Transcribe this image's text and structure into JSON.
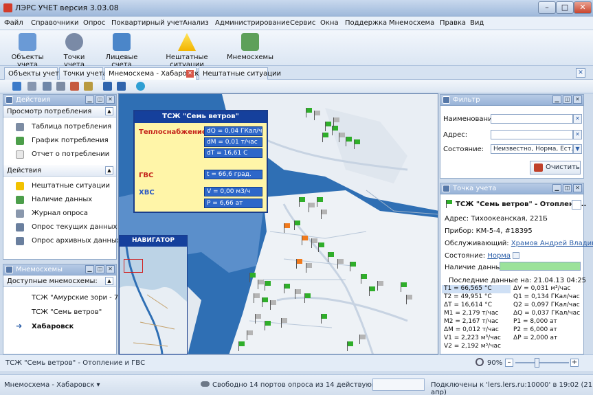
{
  "window": {
    "title": "ЛЭРС УЧЕТ версия 3.03.08"
  },
  "menu": [
    "Файл",
    "Справочники",
    "Опрос",
    "Поквартирный учет",
    "Анализ",
    "Администрирование",
    "Сервис",
    "Окна",
    "Поддержка",
    "Мнемосхема",
    "Правка",
    "Вид"
  ],
  "ribbon": {
    "buttons": [
      "Объекты учета",
      "Точки учета",
      "Лицевые счета",
      "Нештатные ситуации",
      "Мнемосхемы"
    ]
  },
  "tabs": [
    "Объекты учета",
    "Точки учета",
    "Мнемосхема - Хабаровск",
    "Нештатные ситуации"
  ],
  "actions_panel": {
    "title": "Действия",
    "section1": {
      "title": "Просмотр потребления",
      "items": [
        "Таблица потребления",
        "График потребления",
        "Отчет о потреблении"
      ]
    },
    "section2": {
      "title": "Действия",
      "items": [
        "Нештатные ситуации",
        "Наличие данных",
        "Журнал опроса",
        "Опрос текущих данных",
        "Опрос архивных данных"
      ]
    }
  },
  "mnemo_panel": {
    "title": "Мнемосхемы",
    "section": "Доступные мнемосхемы:",
    "items": [
      "ТСЖ \"Амурские зори - 7\" ...",
      "ТСЖ \"Семь ветров\"",
      "Хабаровск"
    ]
  },
  "infobox": {
    "title": "ТСЖ \"Семь ветров\"",
    "heat_label": "Теплоснабжение",
    "heat_values": [
      "dQ = 0,04 ГКал/ч",
      "dM = 0,01 т/час",
      "dT = 16,61 С"
    ],
    "gvs_label": "ГВС",
    "gvs_values": [
      "t = 66,6 град."
    ],
    "hvs_label": "ХВС",
    "hvs_values": [
      "V = 0,00 м3/ч",
      "P = 6,66 ат"
    ]
  },
  "navigator": {
    "title": "НАВИГАТОР"
  },
  "filter": {
    "title": "Фильтр",
    "name_label": "Наименование:",
    "address_label": "Адрес:",
    "state_label": "Состояние:",
    "state_value": "Неизвестно, Норма, Ест...",
    "clear_button": "Очистить"
  },
  "point": {
    "title": "Точка учета",
    "name": "ТСЖ \"Семь ветров\" - Отоплени...",
    "address_label": "Адрес:",
    "address": "Тихоокеанская, 221Б",
    "device_label": "Прибор:",
    "device": "КМ-5-4, #18395",
    "service_label": "Обслуживающий:",
    "service": "Храмов Андрей Владими...",
    "state_label": "Состояние:",
    "state": "Норма",
    "data_label": "Наличие данных:",
    "last_data": "Последние данные на: 21.04.13 04:25",
    "left_values": [
      "T1 = 66,565 °C",
      "T2 = 49,951 °C",
      "ΔT = 16,614 °C",
      "M1 = 2,179 т/час",
      "M2 = 2,167 т/час",
      "ΔM = 0,012 т/час",
      "V1 = 2,223 м³/час",
      "V2 = 2,192 м³/час"
    ],
    "right_values": [
      "ΔV = 0,031 м³/час",
      "Q1 = 0,134 ГКал/час",
      "Q2 = 0,097 ГКал/час",
      "ΔQ = 0,037 ГКал/час",
      "P1 = 8,000 ат",
      "P2 = 6,000 ат",
      "ΔP = 2,000 ат"
    ]
  },
  "status1": {
    "text": "ТСЖ \"Семь ветров\" - Отопление и ГВС",
    "zoom": "90%"
  },
  "status2": {
    "left": "Мнемосхема - Хабаровск",
    "ports": "Свободно 14 портов опроса из 14 действующих",
    "connection": "Подключены к 'lers.lers.ru:10000' в 19:02 (21 апр)"
  }
}
